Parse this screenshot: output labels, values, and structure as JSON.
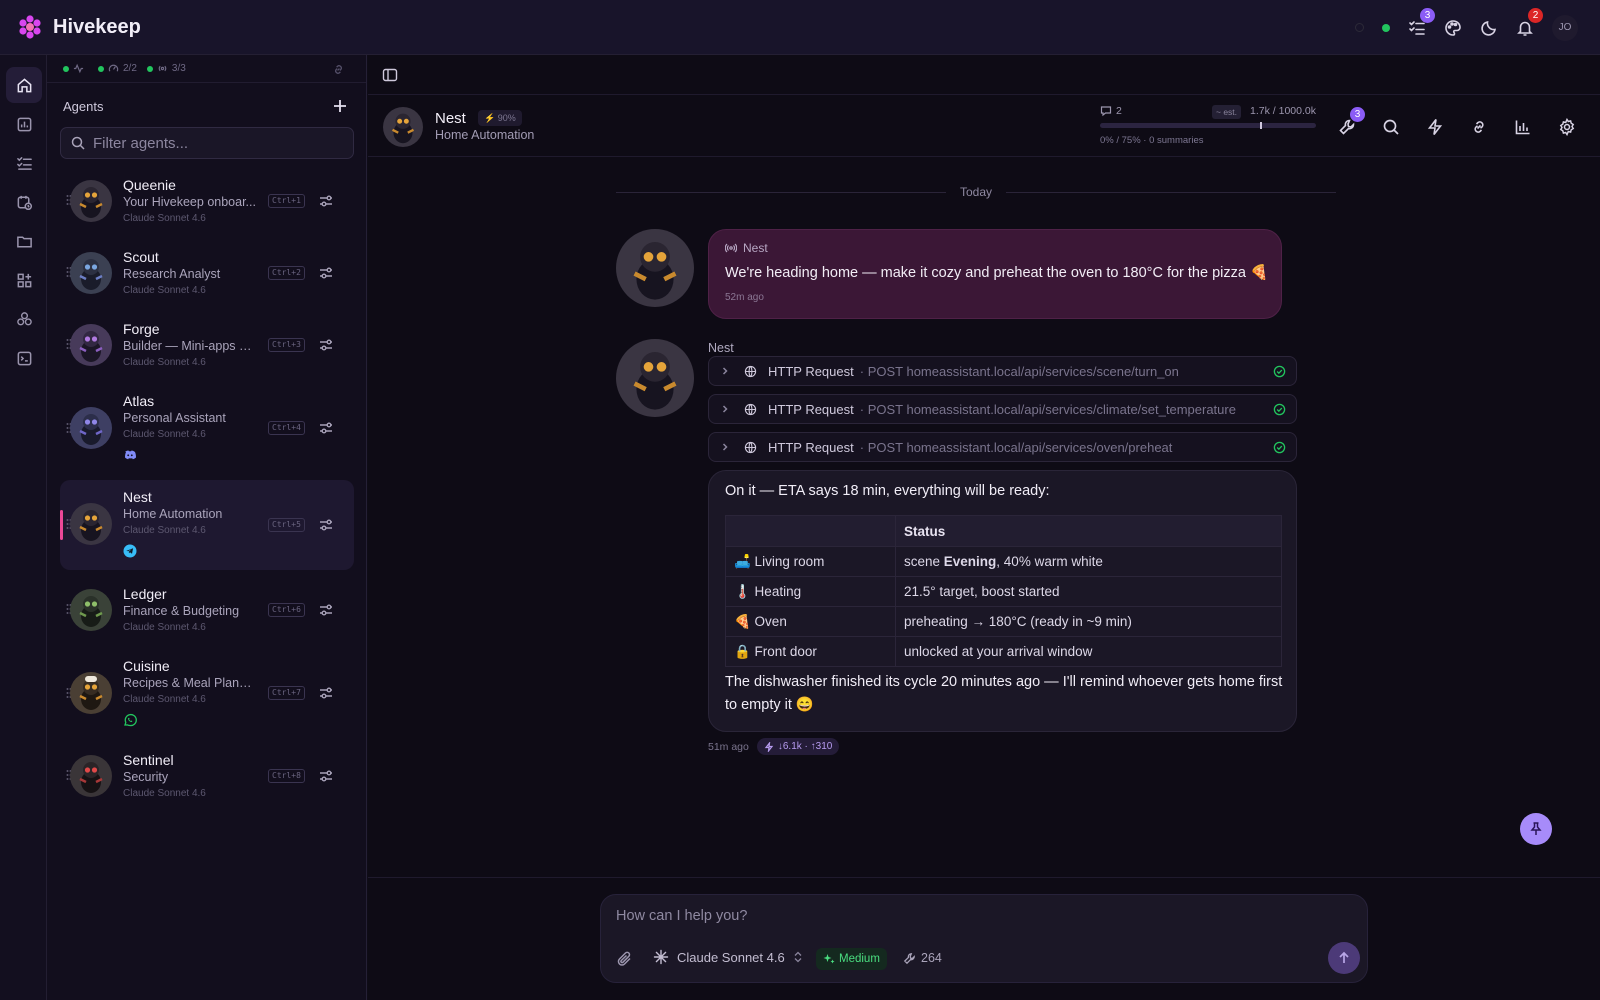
{
  "app": {
    "name": "Hivekeep",
    "user_initials": "JO"
  },
  "topbar": {
    "tasks_badge": "3",
    "notifications_badge": "2"
  },
  "status": {
    "health_value": "",
    "workers": "2/2",
    "channels": "3/3"
  },
  "sidebar": {
    "heading": "Agents",
    "filter_placeholder": "Filter agents...",
    "agents": [
      {
        "name": "Queenie",
        "desc": "Your Hivekeep onboar...",
        "model": "Claude Sonnet 4.6",
        "shortcut": "Ctrl+1",
        "channel": ""
      },
      {
        "name": "Scout",
        "desc": "Research Analyst",
        "model": "Claude Sonnet 4.6",
        "shortcut": "Ctrl+2",
        "channel": ""
      },
      {
        "name": "Forge",
        "desc": "Builder — Mini-apps & ...",
        "model": "Claude Sonnet 4.6",
        "shortcut": "Ctrl+3",
        "channel": ""
      },
      {
        "name": "Atlas",
        "desc": "Personal Assistant",
        "model": "Claude Sonnet 4.6",
        "shortcut": "Ctrl+4",
        "channel": "discord-icon"
      },
      {
        "name": "Nest",
        "desc": "Home Automation",
        "model": "Claude Sonnet 4.6",
        "shortcut": "Ctrl+5",
        "channel": "telegram-icon"
      },
      {
        "name": "Ledger",
        "desc": "Finance & Budgeting",
        "model": "Claude Sonnet 4.6",
        "shortcut": "Ctrl+6",
        "channel": ""
      },
      {
        "name": "Cuisine",
        "desc": "Recipes & Meal Planni...",
        "model": "Claude Sonnet 4.6",
        "shortcut": "Ctrl+7",
        "channel": "whatsapp-icon"
      },
      {
        "name": "Sentinel",
        "desc": "Security",
        "model": "Claude Sonnet 4.6",
        "shortcut": "Ctrl+8",
        "channel": ""
      }
    ]
  },
  "chat": {
    "agent_name": "Nest",
    "agent_health": "90%",
    "agent_role": "Home Automation",
    "context": {
      "messages": "2",
      "est_label": "~ est.",
      "tokens": "1.7k / 1000.0k",
      "footer": "0% / 75% · 0 summaries"
    },
    "tools_badge": "3",
    "date_divider": "Today",
    "user_message": {
      "sender": "Nest",
      "text": "We're heading home — make it cozy and preheat the oven to 180°C for the pizza 🍕",
      "time": "52m ago"
    },
    "assistant_name": "Nest",
    "tool_calls": [
      {
        "name": "HTTP Request",
        "detail": "· POST homeassistant.local/api/services/scene/turn_on"
      },
      {
        "name": "HTTP Request",
        "detail": "· POST homeassistant.local/api/services/climate/set_temperature"
      },
      {
        "name": "HTTP Request",
        "detail": "· POST homeassistant.local/api/services/oven/preheat"
      }
    ],
    "reply_intro": "On it — ETA says 18 min, everything will be ready:",
    "table": {
      "headers": [
        "",
        "Status"
      ],
      "rows": [
        {
          "item": "🛋️ Living room",
          "status_pre": "scene ",
          "status_bold": "Evening",
          "status_post": ", 40% warm white"
        },
        {
          "item": "🌡️ Heating",
          "status_pre": "21.5° target, boost started",
          "status_bold": "",
          "status_post": ""
        },
        {
          "item": "🍕 Oven",
          "status_pre": "preheating → 180°C (ready in ~9 min)",
          "status_bold": "",
          "status_post": ""
        },
        {
          "item": "🔒 Front door",
          "status_pre": "unlocked at your arrival window",
          "status_bold": "",
          "status_post": ""
        }
      ]
    },
    "reply_outro": "The dishwasher finished its cycle 20 minutes ago — I'll remind whoever gets home first to empty it 😄",
    "reply_time": "51m ago",
    "reply_tokens": "↓6.1k · ↑310"
  },
  "composer": {
    "placeholder": "How can I help you?",
    "model": "Claude Sonnet 4.6",
    "effort": "Medium",
    "tool_count": "264"
  },
  "colors": {
    "accent": "#8b5cf6",
    "user_bubble": "#3b1736",
    "success": "#22c55e",
    "selected_bar": "#ec4899"
  }
}
